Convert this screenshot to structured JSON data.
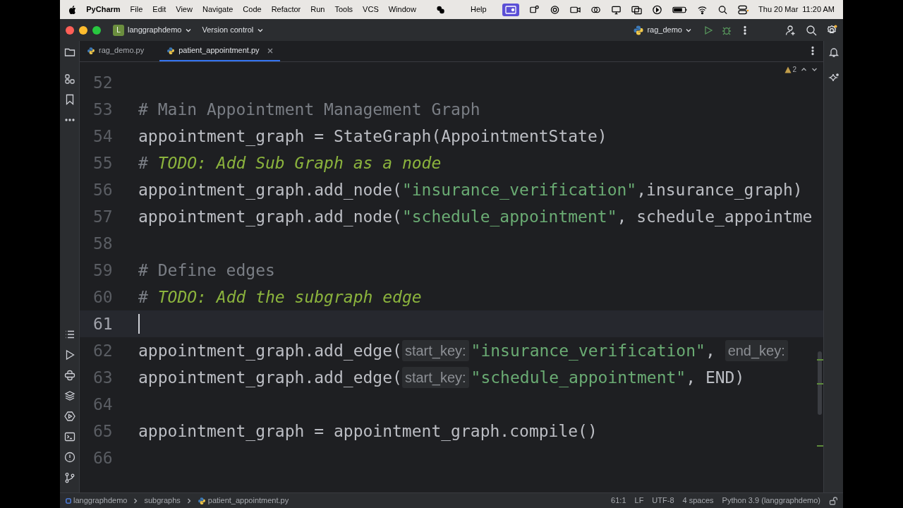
{
  "menu_bar": {
    "app": "PyCharm",
    "items": [
      "File",
      "Edit",
      "View",
      "Navigate",
      "Code",
      "Refactor",
      "Run",
      "Tools",
      "VCS",
      "Window"
    ],
    "help": "Help",
    "date": "Thu 20 Mar",
    "time": "11:20 AM"
  },
  "title_bar": {
    "project_badge": "L",
    "project": "langgraphdemo",
    "vcs": "Version control",
    "run_config": "rag_demo"
  },
  "tabs": [
    {
      "label": "rag_demo.py",
      "selected": false,
      "closable": false
    },
    {
      "label": "patient_appointment.py",
      "selected": true,
      "closable": true
    }
  ],
  "editor": {
    "warnings": "2",
    "lines": [
      {
        "number": "52",
        "current": false
      },
      {
        "number": "53",
        "current": false,
        "segments": [
          {
            "kind": "comment",
            "text": "# Main Appointment Management Graph"
          }
        ]
      },
      {
        "number": "54",
        "current": false,
        "segments": [
          {
            "kind": "plain",
            "text": "appointment_graph = StateGraph(AppointmentState)"
          }
        ]
      },
      {
        "number": "55",
        "current": false,
        "segments": [
          {
            "kind": "comment",
            "text": "# "
          },
          {
            "kind": "todo",
            "text": "TODO: Add Sub Graph as a node"
          }
        ]
      },
      {
        "number": "56",
        "current": false,
        "segments": [
          {
            "kind": "plain",
            "text": "appointment_graph.add_node("
          },
          {
            "kind": "string",
            "text": "\"insurance_verification\""
          },
          {
            "kind": "plain",
            "text": ",insurance_graph)"
          }
        ]
      },
      {
        "number": "57",
        "current": false,
        "segments": [
          {
            "kind": "plain",
            "text": "appointment_graph.add_node("
          },
          {
            "kind": "string",
            "text": "\"schedule_appointment\""
          },
          {
            "kind": "plain",
            "text": ", schedule_appointme"
          }
        ]
      },
      {
        "number": "58",
        "current": false
      },
      {
        "number": "59",
        "current": false,
        "segments": [
          {
            "kind": "comment",
            "text": "# Define edges"
          }
        ]
      },
      {
        "number": "60",
        "current": false,
        "segments": [
          {
            "kind": "comment",
            "text": "# "
          },
          {
            "kind": "todo",
            "text": "TODO: Add the subgraph edge"
          }
        ]
      },
      {
        "number": "61",
        "current": true
      },
      {
        "number": "62",
        "current": false,
        "segments": [
          {
            "kind": "plain",
            "text": "appointment_graph.add_edge("
          },
          {
            "kind": "hint",
            "text": "start_key:"
          },
          {
            "kind": "string",
            "text": "\"insurance_verification\""
          },
          {
            "kind": "plain",
            "text": ", "
          },
          {
            "kind": "hint",
            "text": "end_key:"
          }
        ]
      },
      {
        "number": "63",
        "current": false,
        "segments": [
          {
            "kind": "plain",
            "text": "appointment_graph.add_edge("
          },
          {
            "kind": "hint",
            "text": "start_key:"
          },
          {
            "kind": "string",
            "text": "\"schedule_appointment\""
          },
          {
            "kind": "plain",
            "text": ", END)"
          }
        ]
      },
      {
        "number": "64",
        "current": false
      },
      {
        "number": "65",
        "current": false,
        "segments": [
          {
            "kind": "plain",
            "text": "appointment_graph = appointment_graph.compile()"
          }
        ]
      },
      {
        "number": "66",
        "current": false
      }
    ]
  },
  "breadcrumbs": [
    {
      "kind": "module",
      "label": "langgraphdemo"
    },
    {
      "kind": "folder",
      "label": "subgraphs"
    },
    {
      "kind": "file",
      "label": "patient_appointment.py"
    }
  ],
  "status_bar": [
    "61:1",
    "LF",
    "UTF-8",
    "4 spaces",
    "Python 3.9 (langgraphdemo)"
  ]
}
